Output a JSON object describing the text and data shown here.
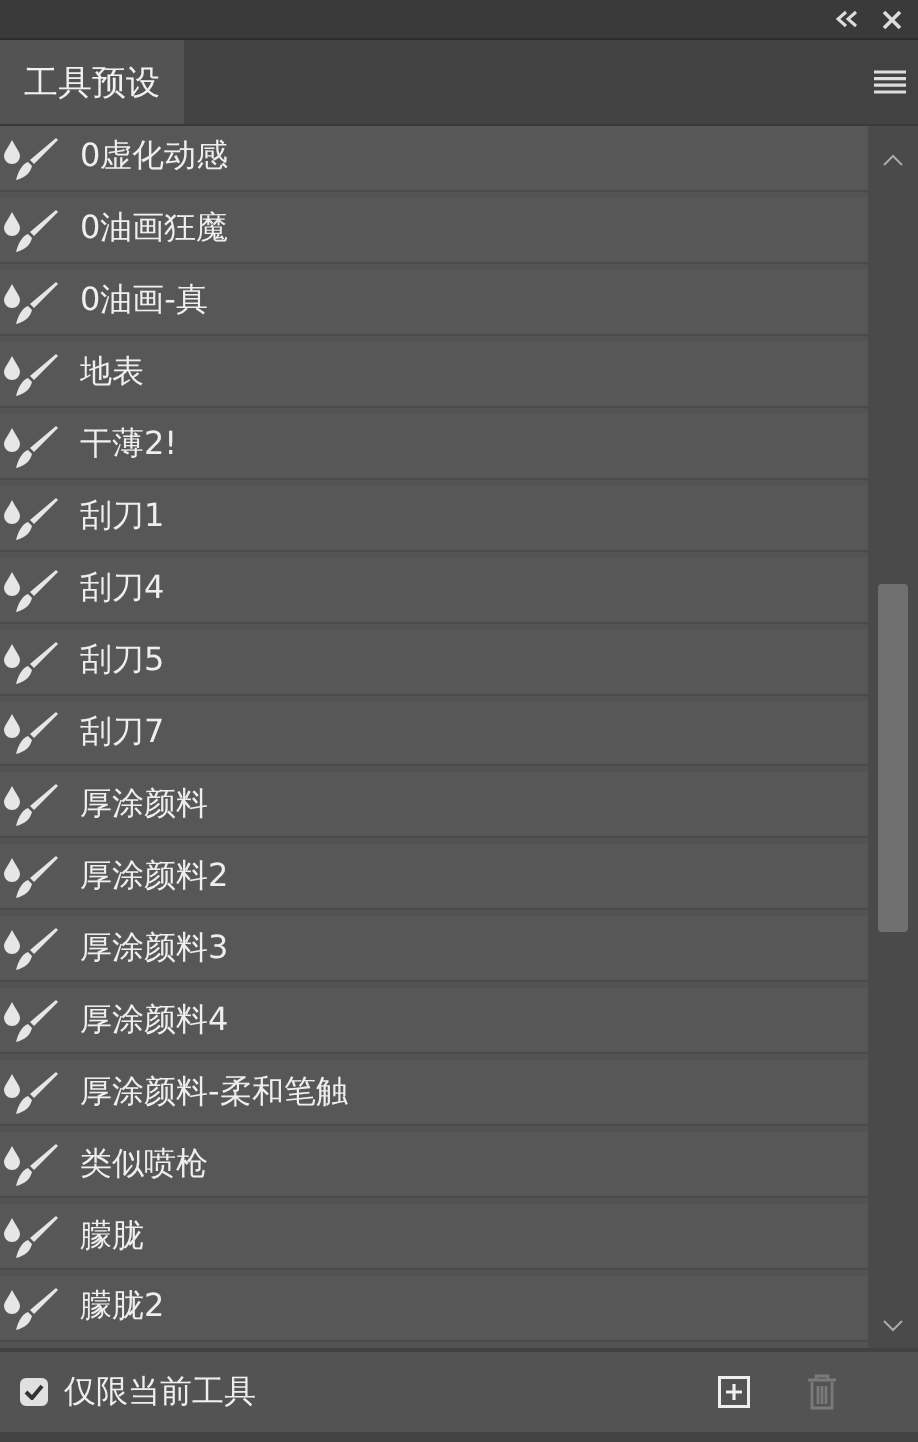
{
  "panel": {
    "tab": {
      "label": "工具预设",
      "selected": true
    }
  },
  "presets": [
    {
      "label": "0虚化动感"
    },
    {
      "label": "0油画狂魔"
    },
    {
      "label": "0油画-真"
    },
    {
      "label": "地表"
    },
    {
      "label": "干薄2!"
    },
    {
      "label": "刮刀1"
    },
    {
      "label": "刮刀4"
    },
    {
      "label": "刮刀5"
    },
    {
      "label": "刮刀7"
    },
    {
      "label": "厚涂颜料"
    },
    {
      "label": "厚涂颜料2"
    },
    {
      "label": "厚涂颜料3"
    },
    {
      "label": "厚涂颜料4"
    },
    {
      "label": "厚涂颜料-柔和笔触"
    },
    {
      "label": "类似喷枪"
    },
    {
      "label": "朦胧"
    },
    {
      "label": "朦胧2"
    }
  ],
  "footer": {
    "current_tool_only": {
      "label": "仅限当前工具",
      "checked": true
    },
    "delete": {
      "disabled": true
    }
  }
}
